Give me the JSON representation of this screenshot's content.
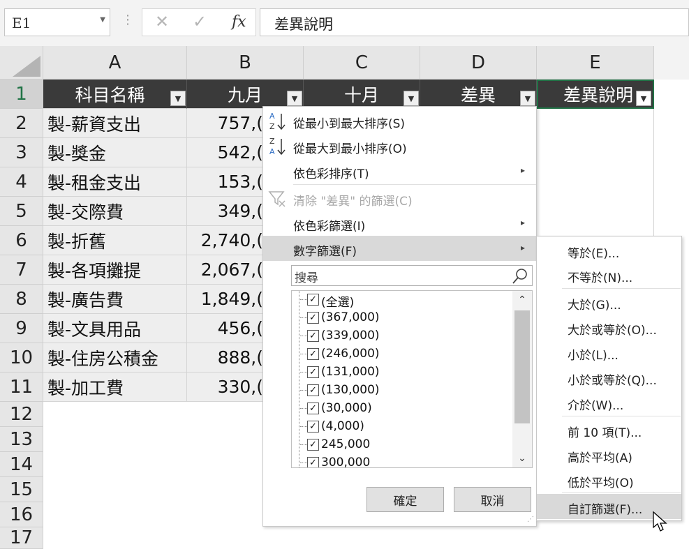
{
  "formula_bar": {
    "name_box": "E1",
    "cancel_glyph": "✕",
    "enter_glyph": "✓",
    "fx_label": "fx",
    "formula": "差異說明"
  },
  "columns": [
    "A",
    "B",
    "C",
    "D",
    "E"
  ],
  "row_numbers": [
    "1",
    "2",
    "3",
    "4",
    "5",
    "6",
    "7",
    "8",
    "9",
    "10",
    "11",
    "12",
    "13",
    "14",
    "15",
    "16",
    "17"
  ],
  "header_row": [
    "科目名稱",
    "九月",
    "十月",
    "差異",
    "差異說明"
  ],
  "rows": [
    {
      "a": "製-薪資支出",
      "b": "757,("
    },
    {
      "a": "製-獎金",
      "b": "542,("
    },
    {
      "a": "製-租金支出",
      "b": "153,("
    },
    {
      "a": "製-交際費",
      "b": "349,("
    },
    {
      "a": "製-折舊",
      "b": "2,740,("
    },
    {
      "a": "製-各項攤提",
      "b": "2,067,("
    },
    {
      "a": "製-廣告費",
      "b": "1,849,("
    },
    {
      "a": "製-文具用品",
      "b": "456,("
    },
    {
      "a": "製-住房公積金",
      "b": "888,("
    },
    {
      "a": "製-加工費",
      "b": "330,("
    }
  ],
  "filter_menu": {
    "items": [
      {
        "label": "從最小到最大排序(S)",
        "icon": "sort-ascending-icon"
      },
      {
        "label": "從最大到最小排序(O)",
        "icon": "sort-descending-icon"
      },
      {
        "label": "依色彩排序(T)",
        "submenu": "▸"
      },
      {
        "label": "清除 \"差異\" 的篩選(C)",
        "icon": "clear-filter-icon",
        "disabled": true
      },
      {
        "label": "依色彩篩選(I)",
        "submenu": "▸"
      },
      {
        "label": "數字篩選(F)",
        "submenu": "▸",
        "highlighted": true
      }
    ],
    "search_placeholder": "搜尋",
    "values": [
      "(全選)",
      "(367,000)",
      "(339,000)",
      "(246,000)",
      "(131,000)",
      "(130,000)",
      "(30,000)",
      "(4,000)",
      "245,000",
      "300,000"
    ],
    "checked_glyph": "✓",
    "scroll_up": "⌃",
    "scroll_down": "⌄",
    "ok_label": "確定",
    "cancel_label": "取消"
  },
  "number_filter_submenu": [
    "等於(E)...",
    "不等於(N)...",
    "大於(G)...",
    "大於或等於(O)...",
    "小於(L)...",
    "小於或等於(Q)...",
    "介於(W)...",
    "前 10 項(T)...",
    "高於平均(A)",
    "低於平均(O)",
    "自訂篩選(F)..."
  ],
  "colors": {
    "header_fill": "#3a3a3a",
    "highlight": "#d9d9d9",
    "selection_border": "#217346",
    "disabled_text": "#a8a8a8"
  }
}
